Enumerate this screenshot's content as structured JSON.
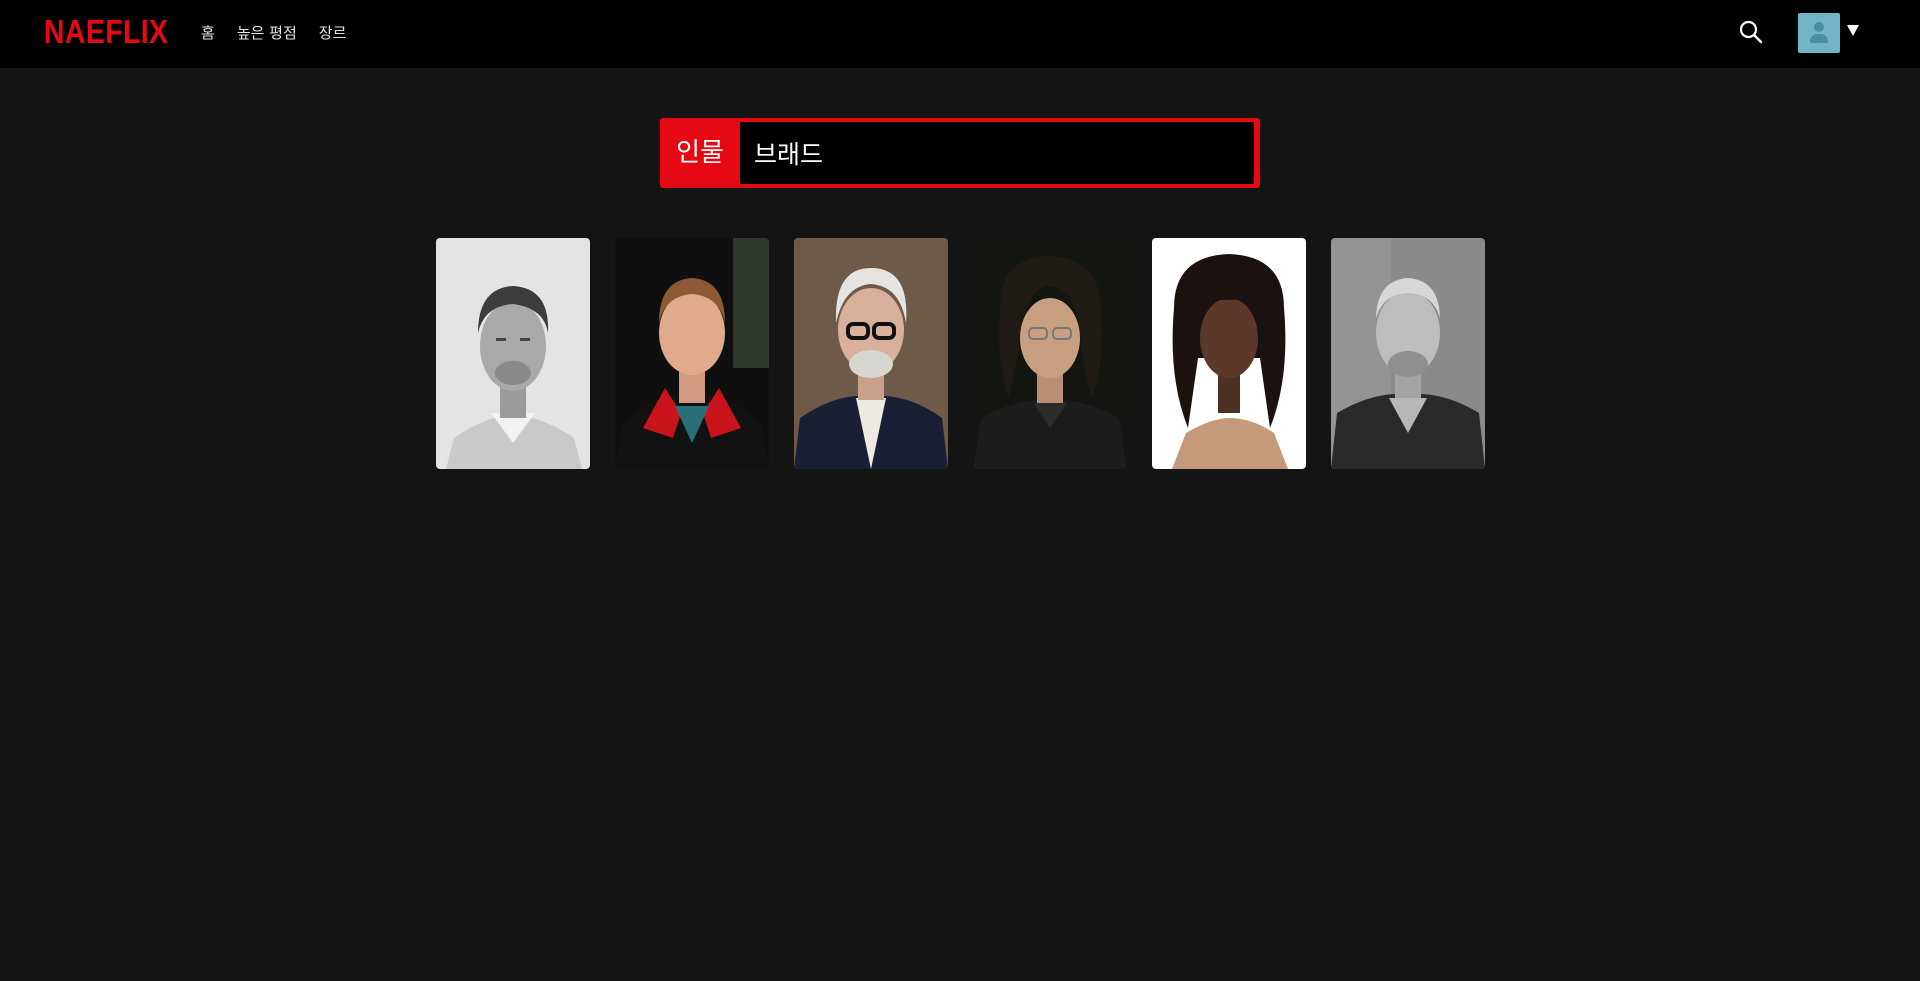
{
  "app": {
    "logo_text": "NAEFLIX",
    "brand_color": "#e50914"
  },
  "nav": {
    "links": [
      {
        "label": "홈"
      },
      {
        "label": "높은 평점"
      },
      {
        "label": "장르"
      }
    ],
    "search_icon": "search-icon",
    "profile_icon": "avatar-icon",
    "dropdown_icon": "caret-down-icon"
  },
  "search": {
    "type_label": "인물",
    "query": "브래드"
  },
  "results": {
    "people": [
      {
        "photo": "person-photo",
        "tone": "grayscale-light"
      },
      {
        "photo": "person-photo",
        "tone": "color-dark"
      },
      {
        "photo": "person-photo",
        "tone": "color-warm"
      },
      {
        "photo": "person-photo",
        "tone": "color-dark"
      },
      {
        "photo": "person-photo",
        "tone": "color-white"
      },
      {
        "photo": "person-photo",
        "tone": "grayscale"
      }
    ]
  }
}
